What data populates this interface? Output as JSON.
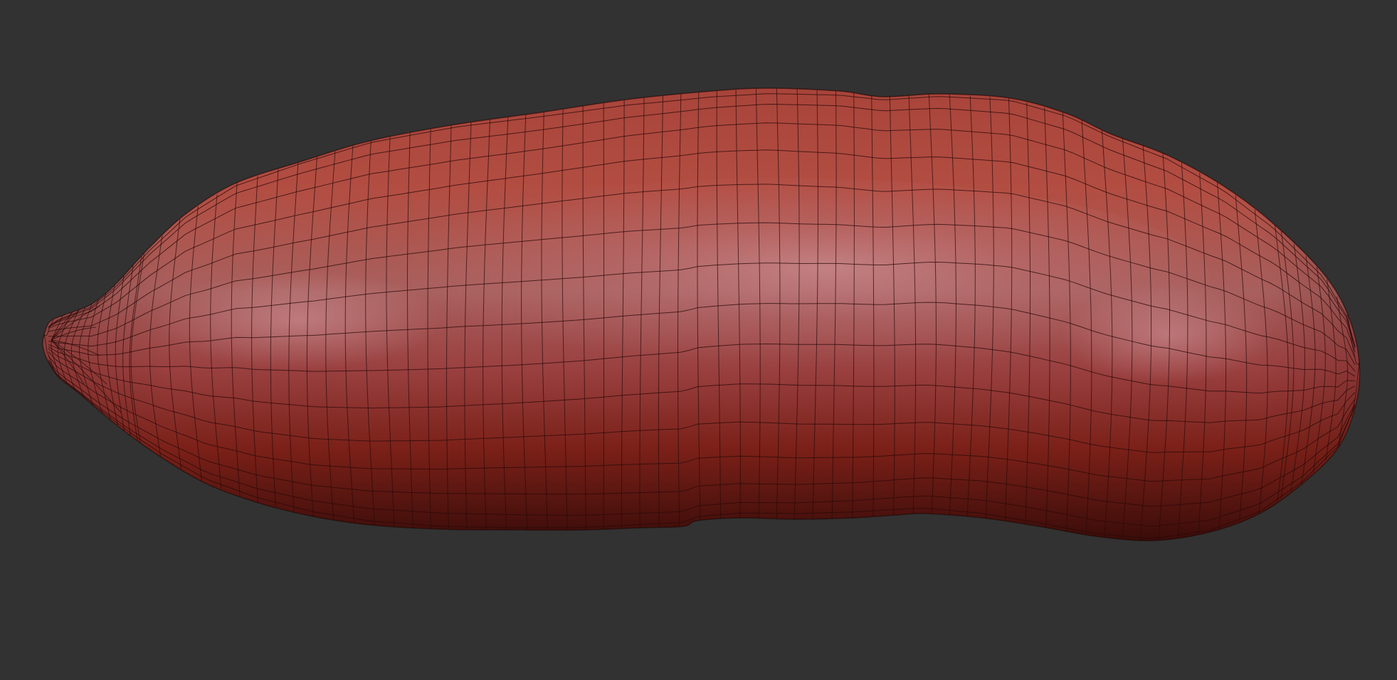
{
  "viewport": {
    "background_color": "#323232",
    "view_mode": "polyframe-wireframe-overlay"
  },
  "model": {
    "subject": "sweet-potato",
    "material_color": "#b34a3c",
    "highlight_color": "#c98a8e",
    "shadow_color": "#4a0f0c",
    "wireframe_color": "#2a0a08",
    "topology": "quad-grid"
  }
}
